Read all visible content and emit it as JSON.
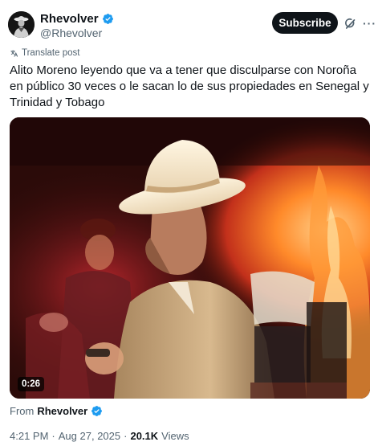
{
  "author": {
    "display_name": "Rhevolver",
    "handle": "@Rhevolver",
    "verified": true,
    "avatar_icon": "avatar-image"
  },
  "actions": {
    "subscribe_label": "Subscribe",
    "grok_icon": "grok-icon",
    "more_icon": "more-icon"
  },
  "translate": {
    "label": "Translate post",
    "icon": "translate-icon"
  },
  "post": {
    "text": "Alito Moreno leyendo que va a tener que disculparse con Noroña en público 30 veces o le sacan lo de sus propiedades en Senegal y Trinidad y Tobago"
  },
  "media": {
    "duration": "0:26"
  },
  "from": {
    "prefix": "From",
    "name": "Rhevolver"
  },
  "meta": {
    "time": "4:21 PM",
    "sep1": "·",
    "date": "Aug 27, 2025",
    "sep2": "·",
    "views_count": "20.1K",
    "views_label": "Views"
  },
  "colors": {
    "verified_blue": "#1d9bf0",
    "text_primary": "#0f1419",
    "text_secondary": "#536471",
    "button_bg": "#0f1419"
  }
}
